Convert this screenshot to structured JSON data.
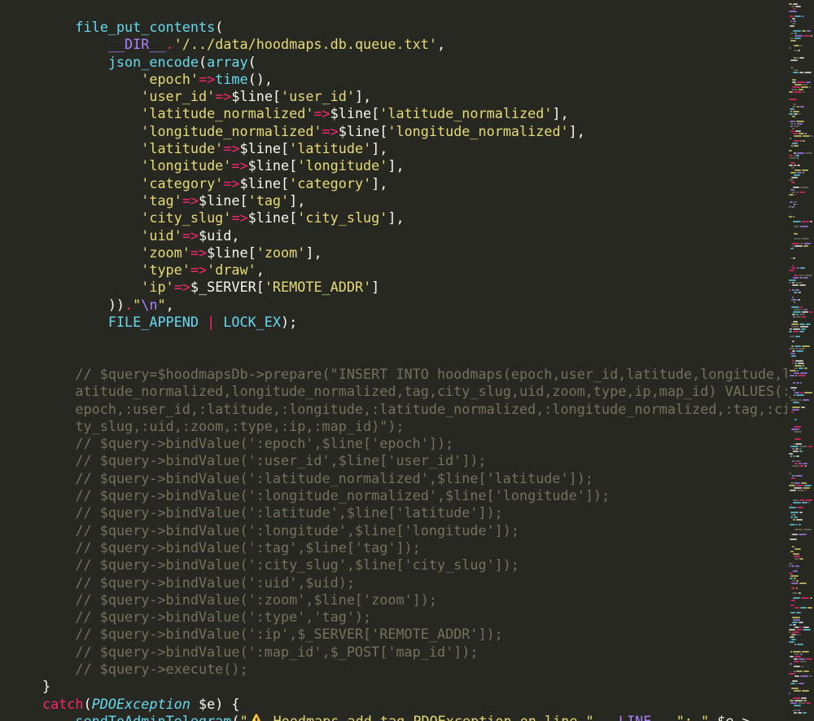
{
  "editor": {
    "theme": "monokai",
    "colors": {
      "background": "#272822",
      "plain": "#f8f8f2",
      "function": "#66d9ef",
      "constant": "#ae81ff",
      "string": "#e6db74",
      "operator": "#f92672",
      "comment": "#75715e"
    }
  },
  "code_lines": [
    [
      [
        "plain",
        "    "
      ],
      [
        "fn",
        "file_put_contents"
      ],
      [
        "plain",
        "("
      ]
    ],
    [
      [
        "plain",
        "        "
      ],
      [
        "const",
        "__DIR__"
      ],
      [
        "op",
        "."
      ],
      [
        "str",
        "'/../data/hoodmaps.db.queue.txt'"
      ],
      [
        "plain",
        ","
      ]
    ],
    [
      [
        "plain",
        "        "
      ],
      [
        "fn",
        "json_encode"
      ],
      [
        "plain",
        "("
      ],
      [
        "fn",
        "array"
      ],
      [
        "plain",
        "("
      ]
    ],
    [
      [
        "plain",
        "            "
      ],
      [
        "str",
        "'epoch'"
      ],
      [
        "op",
        "=>"
      ],
      [
        "fn",
        "time"
      ],
      [
        "plain",
        "(),"
      ]
    ],
    [
      [
        "plain",
        "            "
      ],
      [
        "str",
        "'user_id'"
      ],
      [
        "op",
        "=>"
      ],
      [
        "plain",
        "$line["
      ],
      [
        "str",
        "'user_id'"
      ],
      [
        "plain",
        "],"
      ]
    ],
    [
      [
        "plain",
        "            "
      ],
      [
        "str",
        "'latitude_normalized'"
      ],
      [
        "op",
        "=>"
      ],
      [
        "plain",
        "$line["
      ],
      [
        "str",
        "'latitude_normalized'"
      ],
      [
        "plain",
        "],"
      ]
    ],
    [
      [
        "plain",
        "            "
      ],
      [
        "str",
        "'longitude_normalized'"
      ],
      [
        "op",
        "=>"
      ],
      [
        "plain",
        "$line["
      ],
      [
        "str",
        "'longitude_normalized'"
      ],
      [
        "plain",
        "],"
      ]
    ],
    [
      [
        "plain",
        "            "
      ],
      [
        "str",
        "'latitude'"
      ],
      [
        "op",
        "=>"
      ],
      [
        "plain",
        "$line["
      ],
      [
        "str",
        "'latitude'"
      ],
      [
        "plain",
        "],"
      ]
    ],
    [
      [
        "plain",
        "            "
      ],
      [
        "str",
        "'longitude'"
      ],
      [
        "op",
        "=>"
      ],
      [
        "plain",
        "$line["
      ],
      [
        "str",
        "'longitude'"
      ],
      [
        "plain",
        "],"
      ]
    ],
    [
      [
        "plain",
        "            "
      ],
      [
        "str",
        "'category'"
      ],
      [
        "op",
        "=>"
      ],
      [
        "plain",
        "$line["
      ],
      [
        "str",
        "'category'"
      ],
      [
        "plain",
        "],"
      ]
    ],
    [
      [
        "plain",
        "            "
      ],
      [
        "str",
        "'tag'"
      ],
      [
        "op",
        "=>"
      ],
      [
        "plain",
        "$line["
      ],
      [
        "str",
        "'tag'"
      ],
      [
        "plain",
        "],"
      ]
    ],
    [
      [
        "plain",
        "            "
      ],
      [
        "str",
        "'city_slug'"
      ],
      [
        "op",
        "=>"
      ],
      [
        "plain",
        "$line["
      ],
      [
        "str",
        "'city_slug'"
      ],
      [
        "plain",
        "],"
      ]
    ],
    [
      [
        "plain",
        "            "
      ],
      [
        "str",
        "'uid'"
      ],
      [
        "op",
        "=>"
      ],
      [
        "plain",
        "$uid,"
      ]
    ],
    [
      [
        "plain",
        "            "
      ],
      [
        "str",
        "'zoom'"
      ],
      [
        "op",
        "=>"
      ],
      [
        "plain",
        "$line["
      ],
      [
        "str",
        "'zoom'"
      ],
      [
        "plain",
        "],"
      ]
    ],
    [
      [
        "plain",
        "            "
      ],
      [
        "str",
        "'type'"
      ],
      [
        "op",
        "=>"
      ],
      [
        "str",
        "'draw'"
      ],
      [
        "plain",
        ","
      ]
    ],
    [
      [
        "plain",
        "            "
      ],
      [
        "str",
        "'ip'"
      ],
      [
        "op",
        "=>"
      ],
      [
        "plain",
        "$_SERVER["
      ],
      [
        "str",
        "'REMOTE_ADDR'"
      ],
      [
        "plain",
        "]"
      ]
    ],
    [
      [
        "plain",
        "        "
      ],
      [
        "plain",
        "))"
      ],
      [
        "op",
        "."
      ],
      [
        "str",
        "\""
      ],
      [
        "const",
        "\\n"
      ],
      [
        "str",
        "\""
      ],
      [
        "plain",
        ","
      ]
    ],
    [
      [
        "plain",
        "        "
      ],
      [
        "fn",
        "FILE_APPEND"
      ],
      [
        "op",
        " | "
      ],
      [
        "fn",
        "LOCK_EX"
      ],
      [
        "plain",
        ");"
      ]
    ],
    [],
    [],
    [
      [
        "plain",
        "    "
      ],
      [
        "cmt",
        "// $query=$hoodmapsDb->prepare(\"INSERT INTO hoodmaps(epoch,user_id,latitude,longitude,l"
      ]
    ],
    [
      [
        "cmt",
        "    atitude_normalized,longitude_normalized,tag,city_slug,uid,zoom,type,ip,map_id) VALUES(:"
      ]
    ],
    [
      [
        "cmt",
        "    epoch,:user_id,:latitude,:longitude,:latitude_normalized,:longitude_normalized,:tag,:ci"
      ]
    ],
    [
      [
        "cmt",
        "    ty_slug,:uid,:zoom,:type,:ip,:map_id)\");"
      ]
    ],
    [
      [
        "plain",
        "    "
      ],
      [
        "cmt",
        "// $query->bindValue(':epoch',$line['epoch']);"
      ]
    ],
    [
      [
        "plain",
        "    "
      ],
      [
        "cmt",
        "// $query->bindValue(':user_id',$line['user_id']);"
      ]
    ],
    [
      [
        "plain",
        "    "
      ],
      [
        "cmt",
        "// $query->bindValue(':latitude_normalized',$line['latitude']);"
      ]
    ],
    [
      [
        "plain",
        "    "
      ],
      [
        "cmt",
        "// $query->bindValue(':longitude_normalized',$line['longitude']);"
      ]
    ],
    [
      [
        "plain",
        "    "
      ],
      [
        "cmt",
        "// $query->bindValue(':latitude',$line['latitude']);"
      ]
    ],
    [
      [
        "plain",
        "    "
      ],
      [
        "cmt",
        "// $query->bindValue(':longitude',$line['longitude']);"
      ]
    ],
    [
      [
        "plain",
        "    "
      ],
      [
        "cmt",
        "// $query->bindValue(':tag',$line['tag']);"
      ]
    ],
    [
      [
        "plain",
        "    "
      ],
      [
        "cmt",
        "// $query->bindValue(':city_slug',$line['city_slug']);"
      ]
    ],
    [
      [
        "plain",
        "    "
      ],
      [
        "cmt",
        "// $query->bindValue(':uid',$uid);"
      ]
    ],
    [
      [
        "plain",
        "    "
      ],
      [
        "cmt",
        "// $query->bindValue(':zoom',$line['zoom']);"
      ]
    ],
    [
      [
        "plain",
        "    "
      ],
      [
        "cmt",
        "// $query->bindValue(':type','tag');"
      ]
    ],
    [
      [
        "plain",
        "    "
      ],
      [
        "cmt",
        "// $query->bindValue(':ip',$_SERVER['REMOTE_ADDR']);"
      ]
    ],
    [
      [
        "plain",
        "    "
      ],
      [
        "cmt",
        "// $query->bindValue(':map_id',$_POST['map_id']);"
      ]
    ],
    [
      [
        "plain",
        "    "
      ],
      [
        "cmt",
        "// $query->execute();"
      ]
    ],
    [
      [
        "plain",
        "}"
      ]
    ],
    [
      [
        "kw",
        "catch"
      ],
      [
        "plain",
        "("
      ],
      [
        "cls",
        "PDOException"
      ],
      [
        "plain",
        " $e) {"
      ]
    ],
    [
      [
        "plain",
        "    "
      ],
      [
        "fn",
        "sendToAdminTelegram"
      ],
      [
        "plain",
        "("
      ],
      [
        "str",
        "\""
      ],
      [
        "emoji",
        "⚠️"
      ],
      [
        "str",
        " Hoodmaps add tag PDOException on line \""
      ],
      [
        "op",
        "."
      ],
      [
        "const",
        "__LINE__"
      ],
      [
        "op",
        "."
      ],
      [
        "str",
        "\": \""
      ],
      [
        "op",
        "."
      ],
      [
        "plain",
        "$e->"
      ]
    ]
  ]
}
